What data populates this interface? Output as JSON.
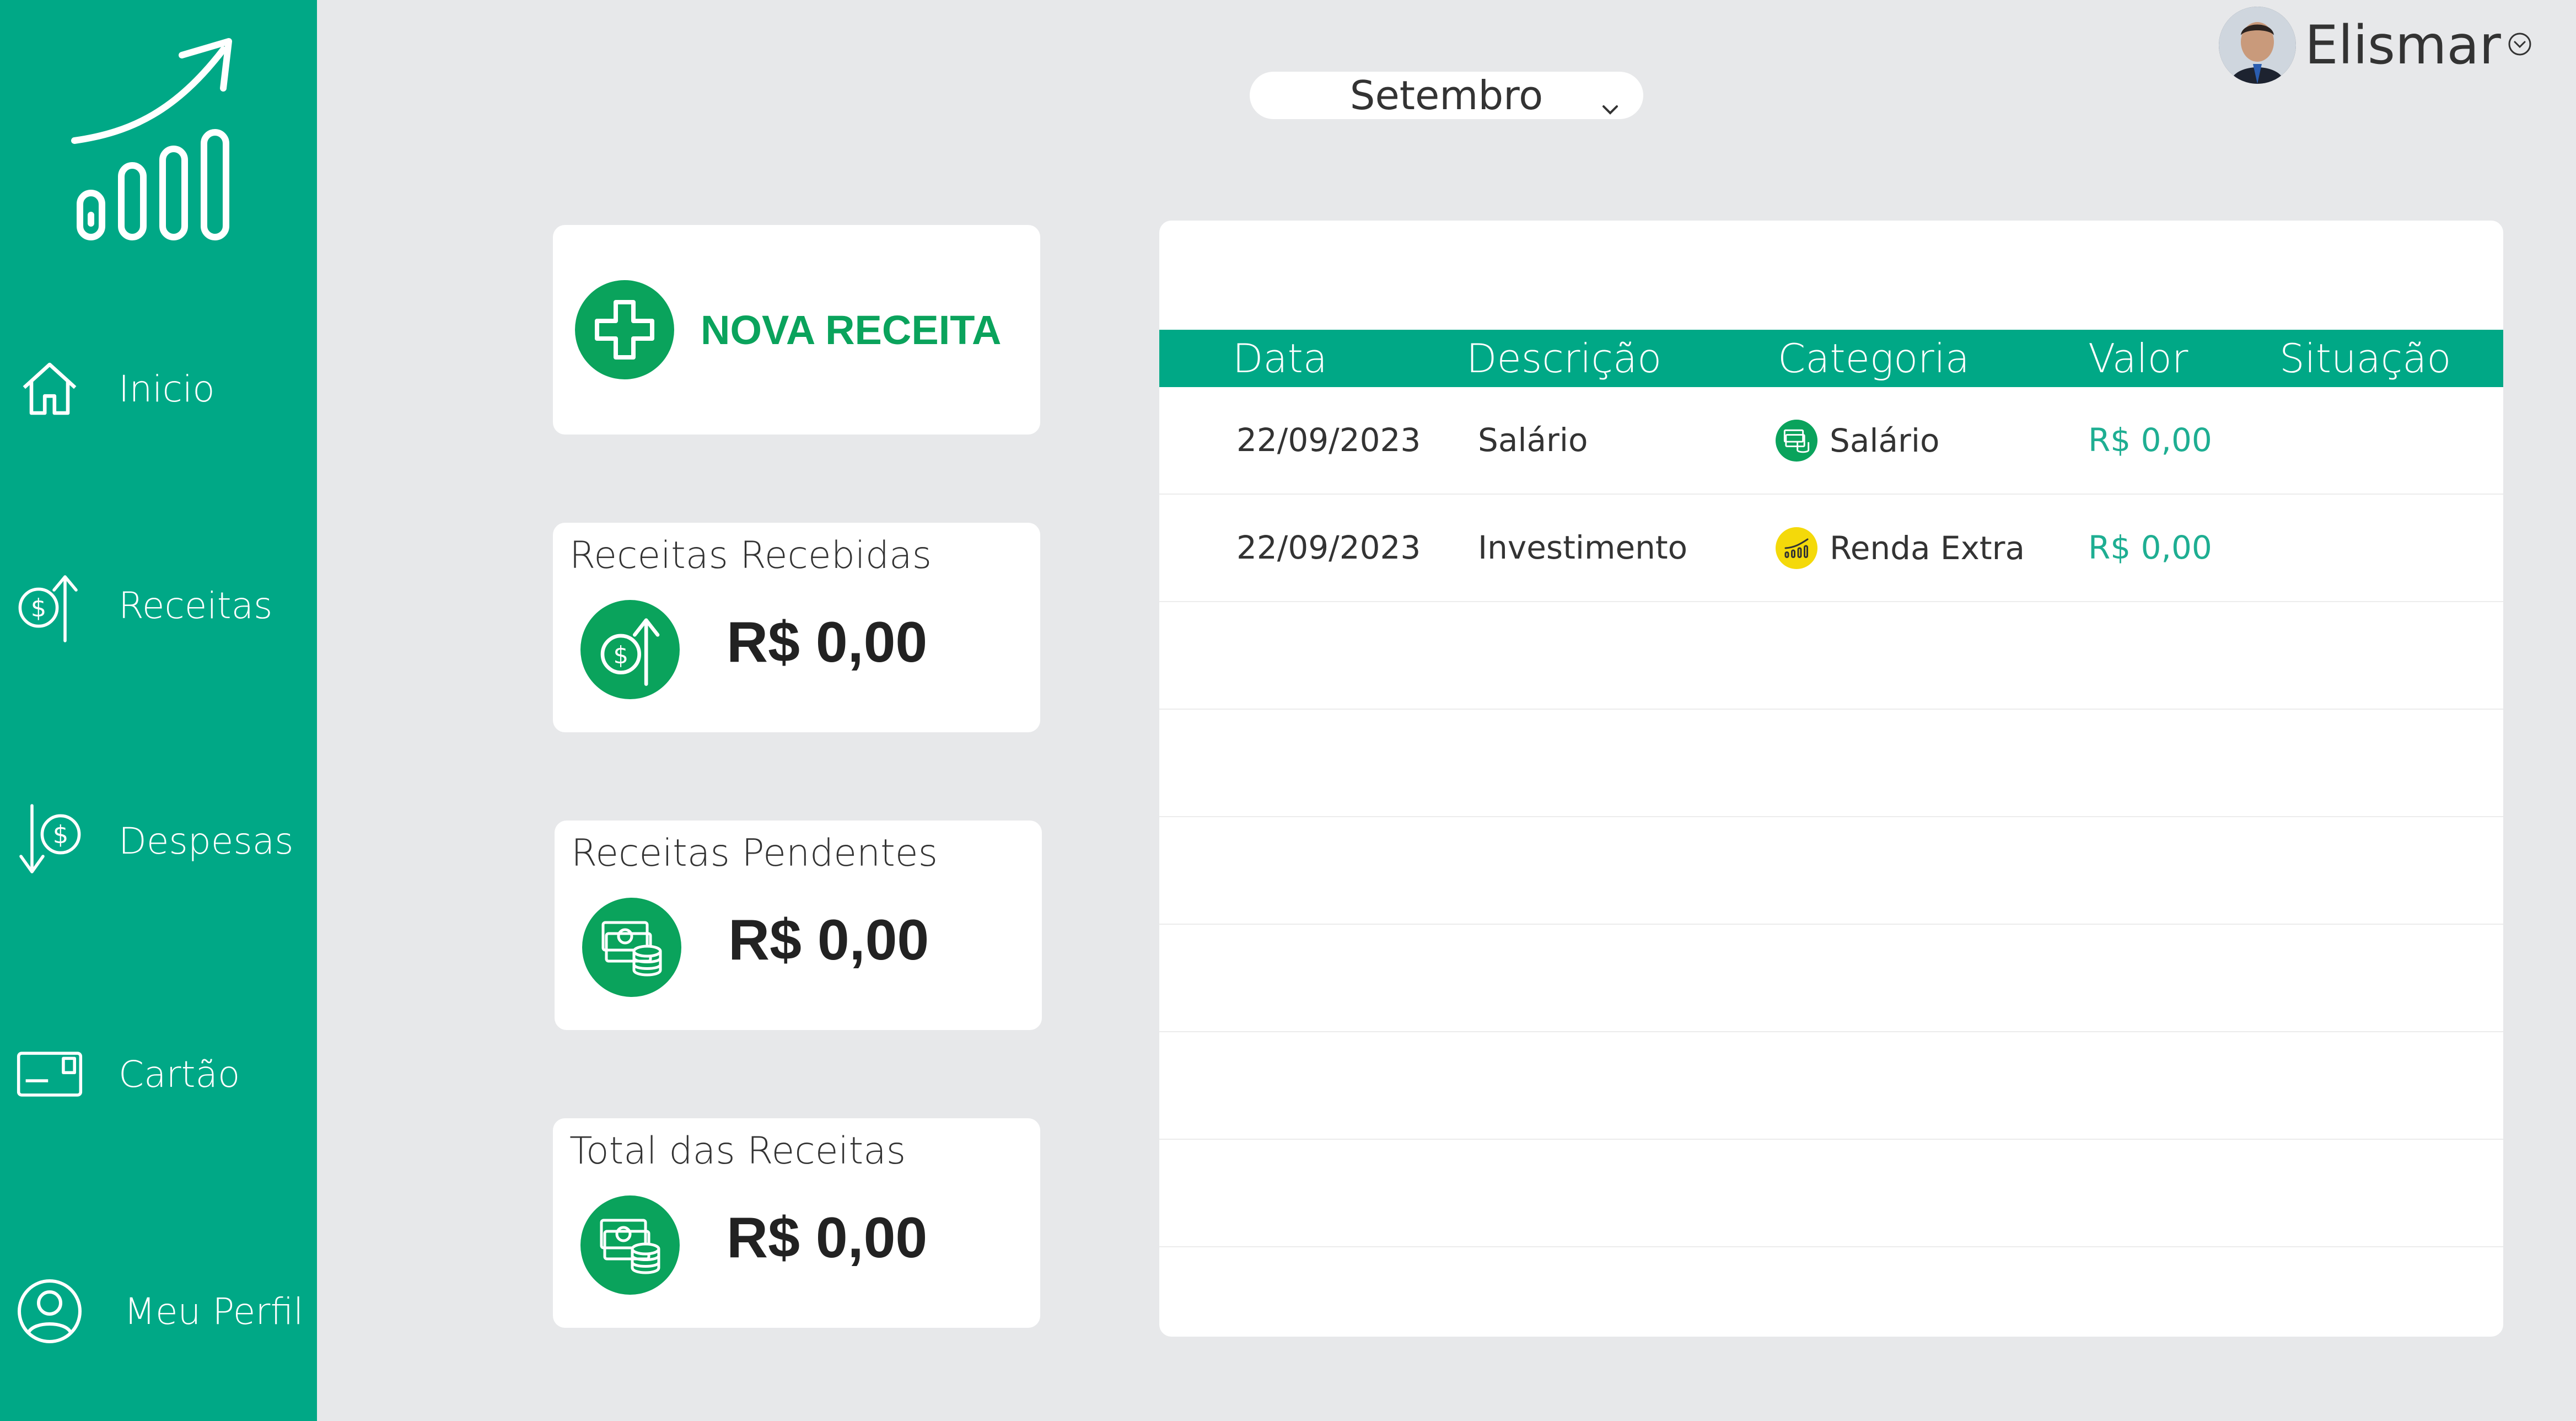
{
  "sidebar": {
    "logo": "growth-chart-logo-icon",
    "items": [
      {
        "label": "Inicio",
        "icon": "home-icon"
      },
      {
        "label": "Receitas",
        "icon": "income-icon"
      },
      {
        "label": "Despesas",
        "icon": "expense-icon"
      },
      {
        "label": "Cartão",
        "icon": "card-icon"
      },
      {
        "label": "Meu Perfil",
        "icon": "profile-icon"
      }
    ]
  },
  "header": {
    "month": "Setembro",
    "user_name": "Elismar"
  },
  "actions": {
    "nova_receita": "NOVA RECEITA"
  },
  "summary": [
    {
      "title": "Receitas Recebidas",
      "value": "R$ 0,00",
      "icon": "income-icon"
    },
    {
      "title": "Receitas Pendentes",
      "value": "R$ 0,00",
      "icon": "money-stack-icon"
    },
    {
      "title": "Total das Receitas",
      "value": "R$ 0,00",
      "icon": "money-stack-icon"
    }
  ],
  "table": {
    "columns": [
      "Data",
      "Descrição",
      "Categoria",
      "Valor",
      "Situação"
    ],
    "rows": [
      {
        "data": "22/09/2023",
        "descricao": "Salário",
        "categoria": "Salário",
        "categoria_icon": "money-icon",
        "categoria_color": "#0aa35c",
        "valor": "R$ 0,00",
        "situacao": ""
      },
      {
        "data": "22/09/2023",
        "descricao": "Investimento",
        "categoria": "Renda Extra",
        "categoria_icon": "chart-icon",
        "categoria_color": "#f4d90a",
        "valor": "R$ 0,00",
        "situacao": ""
      }
    ]
  },
  "colors": {
    "sidebar": "#00a886",
    "accent": "#0aa35c",
    "background": "#e7e8ea",
    "valor": "#1eae92"
  }
}
